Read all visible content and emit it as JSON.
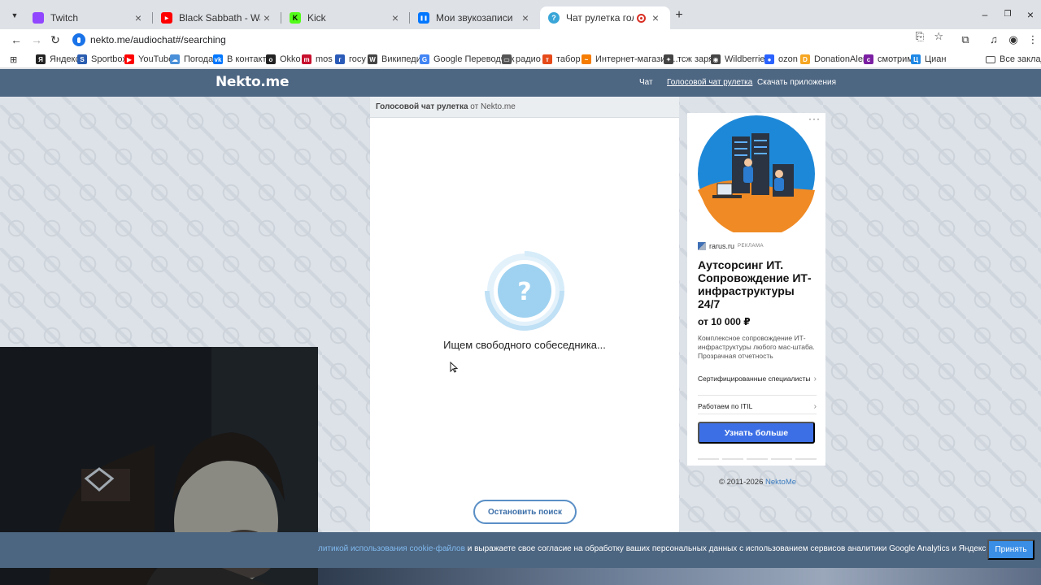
{
  "browser": {
    "tabs": [
      {
        "title": "Twitch",
        "fav_color": "#9146ff",
        "fav_text": ""
      },
      {
        "title": "Black Sabbath - War Pigs - YouT",
        "fav_color": "#ff0000",
        "fav_text": "▶"
      },
      {
        "title": "Kick",
        "fav_color": "#53fc18",
        "fav_text": "K"
      },
      {
        "title": "Мои звукозаписи",
        "fav_color": "#0077ff",
        "fav_text": "❚❚"
      },
      {
        "title": "Чат рулетка голосовая — ",
        "fav_color": "#3aa6d8",
        "fav_text": "?"
      }
    ],
    "url": "nekto.me/audiochat#/searching",
    "bookmarks": [
      {
        "label": "Яндекс",
        "color": "#222",
        "glyph": "Я"
      },
      {
        "label": "Sportbox",
        "color": "#2a5db0",
        "glyph": "S"
      },
      {
        "label": "YouTube",
        "color": "#ff0000",
        "glyph": "▶"
      },
      {
        "label": "Погода",
        "color": "#4a90d9",
        "glyph": "☁"
      },
      {
        "label": "В контакте",
        "color": "#0077ff",
        "glyph": "vk"
      },
      {
        "label": "Okko",
        "color": "#222",
        "glyph": "o"
      },
      {
        "label": "mos",
        "color": "#c8102e",
        "glyph": "m"
      },
      {
        "label": "госу",
        "color": "#2b5bb8",
        "glyph": "г"
      },
      {
        "label": "Википедия",
        "color": "#444",
        "glyph": "W"
      },
      {
        "label": "Google Переводчик",
        "color": "#4285f4",
        "glyph": "G"
      },
      {
        "label": "радио",
        "color": "#555",
        "glyph": "▭"
      },
      {
        "label": "табор",
        "color": "#e64a19",
        "glyph": "т"
      },
      {
        "label": "Интернет-магазин...",
        "color": "#f57c00",
        "glyph": "~"
      },
      {
        "label": "тсж заря",
        "color": "#444",
        "glyph": "✦"
      },
      {
        "label": "Wildberries",
        "color": "#444",
        "glyph": "◉"
      },
      {
        "label": "ozon",
        "color": "#2962ff",
        "glyph": "●"
      },
      {
        "label": "DonationAlerts",
        "color": "#f5a623",
        "glyph": "D"
      },
      {
        "label": "смотрим",
        "color": "#7b1fa2",
        "glyph": "c"
      },
      {
        "label": "Циан",
        "color": "#1e88e5",
        "glyph": "Ц"
      }
    ],
    "all_bookmarks": "Все закладки"
  },
  "site": {
    "logo": "Nekto.me",
    "nav": [
      "Чат",
      "Голосовой чат рулетка",
      "Скачать приложения"
    ],
    "chat_header_bold": "Голосовой чат рулетка",
    "chat_header_rest": " от Nekto.me",
    "searching_text": "Ищем свободного собеседника...",
    "stop_button": "Остановить поиск",
    "copyright_prefix": "© 2011-2026 ",
    "copyright_link": "NektoMe"
  },
  "ad": {
    "source": "rarus.ru",
    "source_label": "РЕКЛАМА",
    "title": "Аутсорсинг ИТ. Сопровождение ИТ-инфраструктуры 24/7",
    "price": "от 10 000 ₽",
    "description": "Комплексное сопровождение ИТ-инфраструктуры любого мас-штаба. Прозрачная отчетность",
    "links": [
      "Сертифицированные специалисты",
      "Работаем по ITIL"
    ],
    "cta": "Узнать больше"
  },
  "cookie": {
    "link_text": "литикой использования cookie-файлов",
    "text": " и выражаете свое согласие на обработку ваших персональных данных с использованием сервисов аналитики Google Analytics и Яндекс Метрика.",
    "accept": "Принять"
  }
}
